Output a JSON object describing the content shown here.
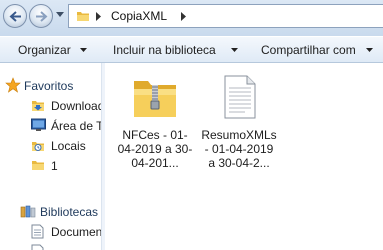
{
  "address": {
    "crumbs": [
      "CopiaXML"
    ]
  },
  "toolbar": {
    "organizar": "Organizar",
    "incluir": "Incluir na biblioteca",
    "compartilhar": "Compartilhar com"
  },
  "nav": {
    "favoritos": "Favoritos",
    "downloads": "Downloads",
    "area_de_trabalho": "Área de Trabalho",
    "locais": "Locais",
    "pasta_1": "1",
    "bibliotecas": "Bibliotecas",
    "documentos": "Documentos"
  },
  "files": [
    {
      "name": "NFCes - 01-04-2019 a 30-04-201...",
      "type": "zip-folder"
    },
    {
      "name": "ResumoXMLs - 01-04-2019 a 30-04-2...",
      "type": "text-file"
    }
  ],
  "colors": {
    "folder": "#f2c94c",
    "selection": "#d7e7f8",
    "toolbar_text": "#1e395b"
  }
}
